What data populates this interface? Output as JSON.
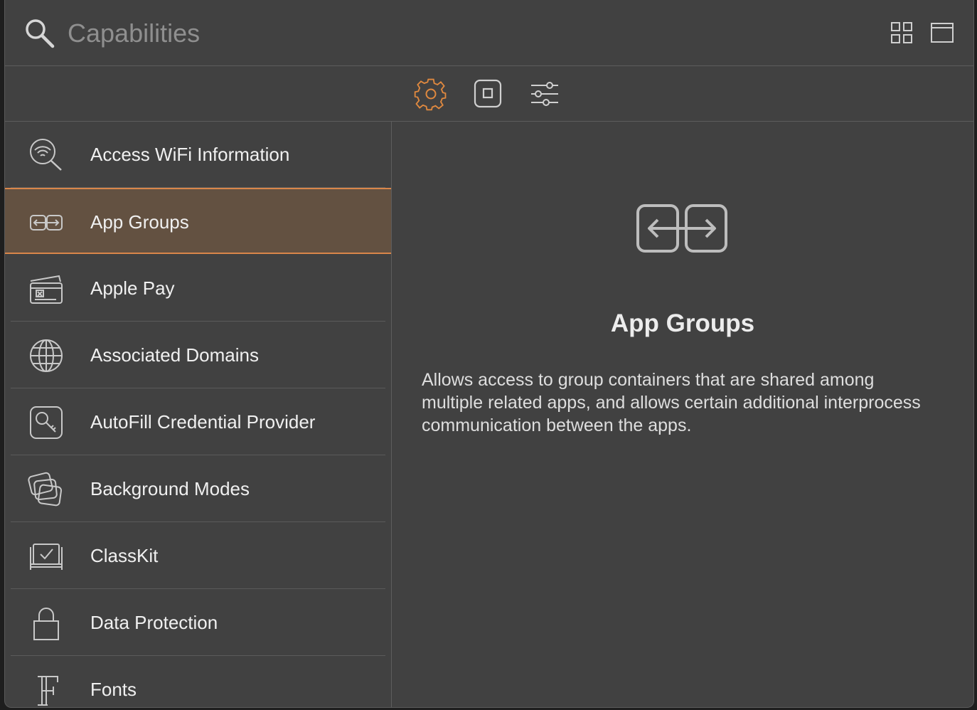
{
  "search": {
    "placeholder": "Capabilities",
    "value": ""
  },
  "header": {
    "view_buttons": [
      "grid-view-icon",
      "single-view-icon"
    ]
  },
  "toolbar": {
    "buttons": [
      {
        "icon": "gear-icon",
        "active": true
      },
      {
        "icon": "stop-square-icon",
        "active": false
      },
      {
        "icon": "sliders-icon",
        "active": false
      }
    ]
  },
  "colors": {
    "accent": "#e0893f",
    "selection_bg": "#635141",
    "panel_bg": "#414141",
    "text": "#f0f0f0"
  },
  "capabilities": {
    "items": [
      {
        "label": "Access WiFi Information",
        "icon": "wifi-search-icon"
      },
      {
        "label": "App Groups",
        "icon": "app-groups-icon",
        "selected": true
      },
      {
        "label": "Apple Pay",
        "icon": "apple-pay-card-icon"
      },
      {
        "label": "Associated Domains",
        "icon": "globe-icon"
      },
      {
        "label": "AutoFill Credential Provider",
        "icon": "key-icon"
      },
      {
        "label": "Background Modes",
        "icon": "stacked-windows-icon"
      },
      {
        "label": "ClassKit",
        "icon": "checkbox-board-icon"
      },
      {
        "label": "Data Protection",
        "icon": "lock-icon"
      },
      {
        "label": "Fonts",
        "icon": "font-icon"
      }
    ]
  },
  "detail": {
    "icon": "app-groups-icon",
    "title": "App Groups",
    "description": "Allows access to group containers that are shared among multiple related apps, and allows certain additional interprocess communication between the apps."
  }
}
